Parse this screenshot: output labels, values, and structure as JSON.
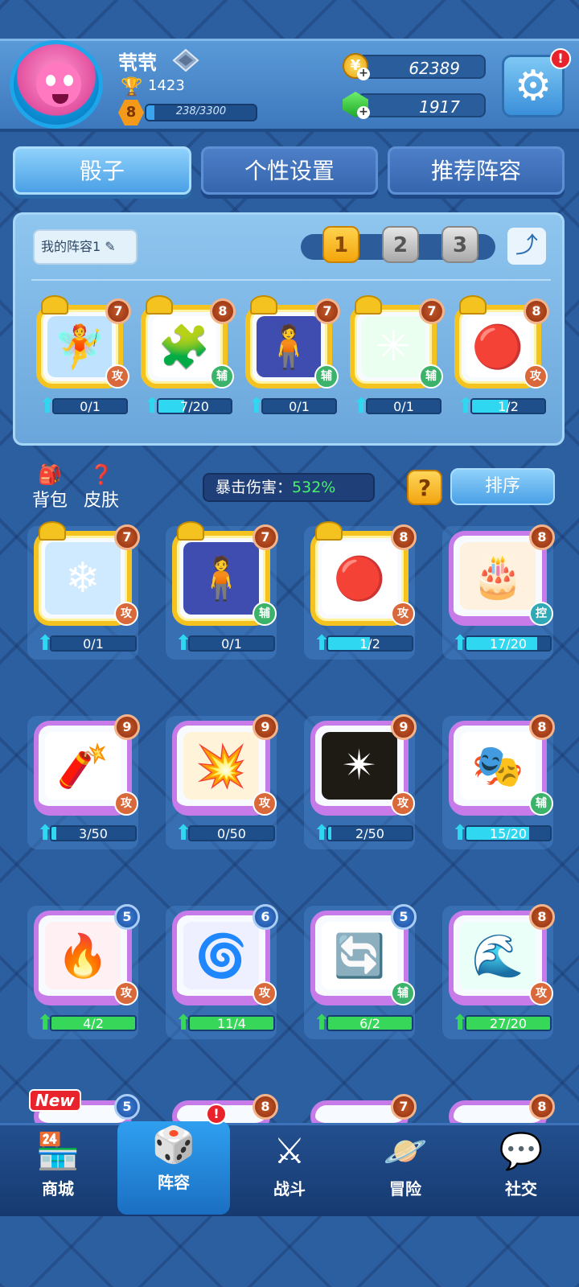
{
  "player": {
    "name": "茕茕",
    "trophies": "1423",
    "level": "8",
    "xp_text": "238/3300",
    "xp_fraction": 0.072
  },
  "currency": {
    "coins": "62389",
    "gems": "1917"
  },
  "settings_alert": "!",
  "tabs": [
    "骰子",
    "个性设置",
    "推荐阵容"
  ],
  "deck": {
    "name_label": "我的阵容1",
    "slots": [
      "1",
      "2",
      "3"
    ],
    "dice": [
      {
        "level": "7",
        "type": "攻",
        "progress": "0/1",
        "fill": 0.0,
        "art": "🧚",
        "color": "#bfe3ff"
      },
      {
        "level": "8",
        "type": "辅",
        "progress": "7/20",
        "fill": 0.35,
        "art": "🧩",
        "color": "#fff"
      },
      {
        "level": "7",
        "type": "辅",
        "progress": "0/1",
        "fill": 0.0,
        "art": "🧍",
        "color": "#3f4db0"
      },
      {
        "level": "7",
        "type": "辅",
        "progress": "0/1",
        "fill": 0.0,
        "art": "✳",
        "color": "#eafff0"
      },
      {
        "level": "8",
        "type": "攻",
        "progress": "1/2",
        "fill": 0.5,
        "art": "🔴",
        "color": "#fff"
      }
    ]
  },
  "mid": {
    "bag_label": "背包",
    "skin_label": "皮肤",
    "crit_label": "暴击伤害：",
    "crit_value": "532%",
    "help": "?",
    "sort_label": "排序"
  },
  "collection": [
    {
      "level": "7",
      "type": "攻",
      "progress": "0/1",
      "fill": 0.0,
      "frame": "gold",
      "art": "❄",
      "color": "#cfe9ff"
    },
    {
      "level": "7",
      "type": "辅",
      "progress": "0/1",
      "fill": 0.0,
      "frame": "gold",
      "art": "🧍",
      "color": "#3f4db0"
    },
    {
      "level": "8",
      "type": "攻",
      "progress": "1/2",
      "fill": 0.5,
      "frame": "gold",
      "art": "🔴",
      "color": "#fff"
    },
    {
      "level": "8",
      "type": "控",
      "progress": "17/20",
      "fill": 0.85,
      "frame": "purple",
      "art": "🎂",
      "color": "#fff1df"
    },
    {
      "level": "9",
      "type": "攻",
      "progress": "3/50",
      "fill": 0.06,
      "frame": "purple",
      "art": "🧨",
      "color": "#fff"
    },
    {
      "level": "9",
      "type": "攻",
      "progress": "0/50",
      "fill": 0.0,
      "frame": "purple",
      "art": "💥",
      "color": "#fff3da"
    },
    {
      "level": "9",
      "type": "攻",
      "progress": "2/50",
      "fill": 0.04,
      "frame": "purple",
      "art": "✴",
      "color": "#1e1a14"
    },
    {
      "level": "8",
      "type": "辅",
      "progress": "15/20",
      "fill": 0.75,
      "frame": "purple",
      "art": "🎭",
      "color": "#fff"
    },
    {
      "level": "5",
      "type": "攻",
      "progress": "4/2",
      "fill": 1.0,
      "frame": "purple",
      "art": "🔥",
      "color": "#fff0f3",
      "ready": true,
      "blue": true
    },
    {
      "level": "6",
      "type": "攻",
      "progress": "11/4",
      "fill": 1.0,
      "frame": "purple",
      "art": "🌀",
      "color": "#eef0ff",
      "ready": true,
      "blue": true
    },
    {
      "level": "5",
      "type": "辅",
      "progress": "6/2",
      "fill": 1.0,
      "frame": "purple",
      "art": "🔄",
      "color": "#fff",
      "ready": true,
      "blue": true
    },
    {
      "level": "8",
      "type": "攻",
      "progress": "27/20",
      "fill": 1.0,
      "frame": "purple",
      "art": "🌊",
      "color": "#e9fff7",
      "ready": true
    }
  ],
  "partial_row": {
    "new_tag": "New",
    "levels": [
      "5",
      "8",
      "7",
      "8"
    ]
  },
  "nav": [
    {
      "label": "商城",
      "icon": "🏪"
    },
    {
      "label": "阵容",
      "icon": "🎲"
    },
    {
      "label": "战斗",
      "icon": "⚔"
    },
    {
      "label": "冒险",
      "icon": "🪐"
    },
    {
      "label": "社交",
      "icon": "💬"
    }
  ],
  "nav_alert": "!"
}
